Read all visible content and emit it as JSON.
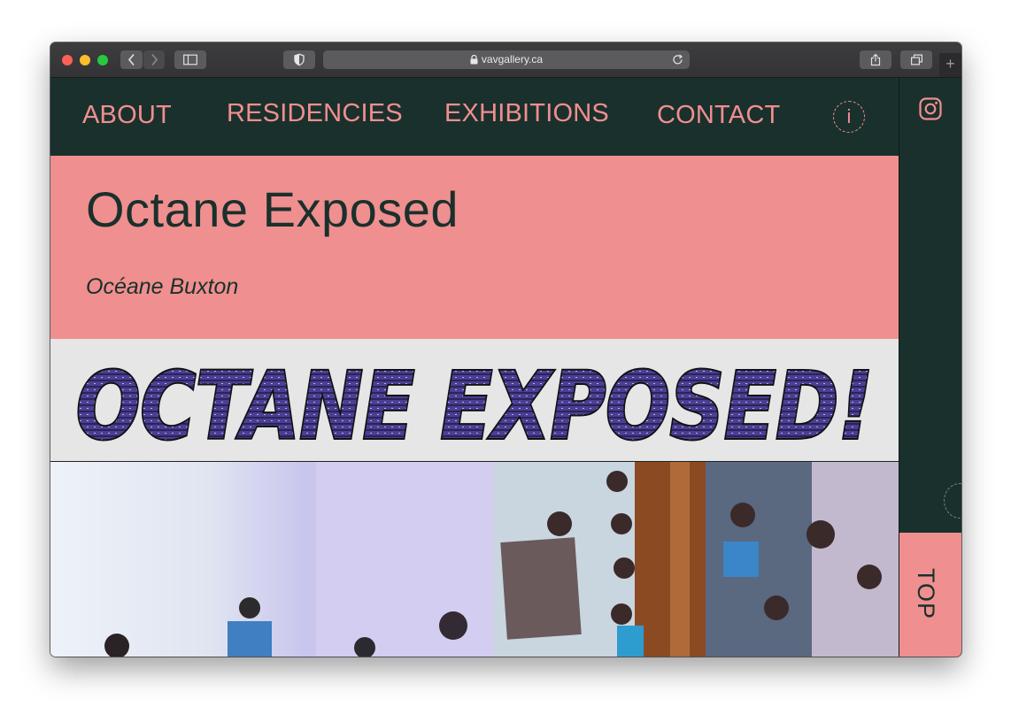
{
  "browser": {
    "url": "vavgallery.ca"
  },
  "nav": {
    "items": [
      {
        "label": "ABOUT"
      },
      {
        "label": "RESIDENCIES"
      },
      {
        "label": "EXHIBITIONS"
      },
      {
        "label": "CONTACT"
      }
    ],
    "info_label": "i"
  },
  "exhibition": {
    "title": "Octane Exposed",
    "artist": "Océane Buxton",
    "banner_text": "OCTANE EXPOSED!"
  },
  "sidebar": {
    "top_label": "TOP",
    "social_icon": "instagram-icon"
  },
  "colors": {
    "dark_green": "#1a302c",
    "pink": "#f08f8f",
    "banner_purple": "#4b3f93"
  }
}
